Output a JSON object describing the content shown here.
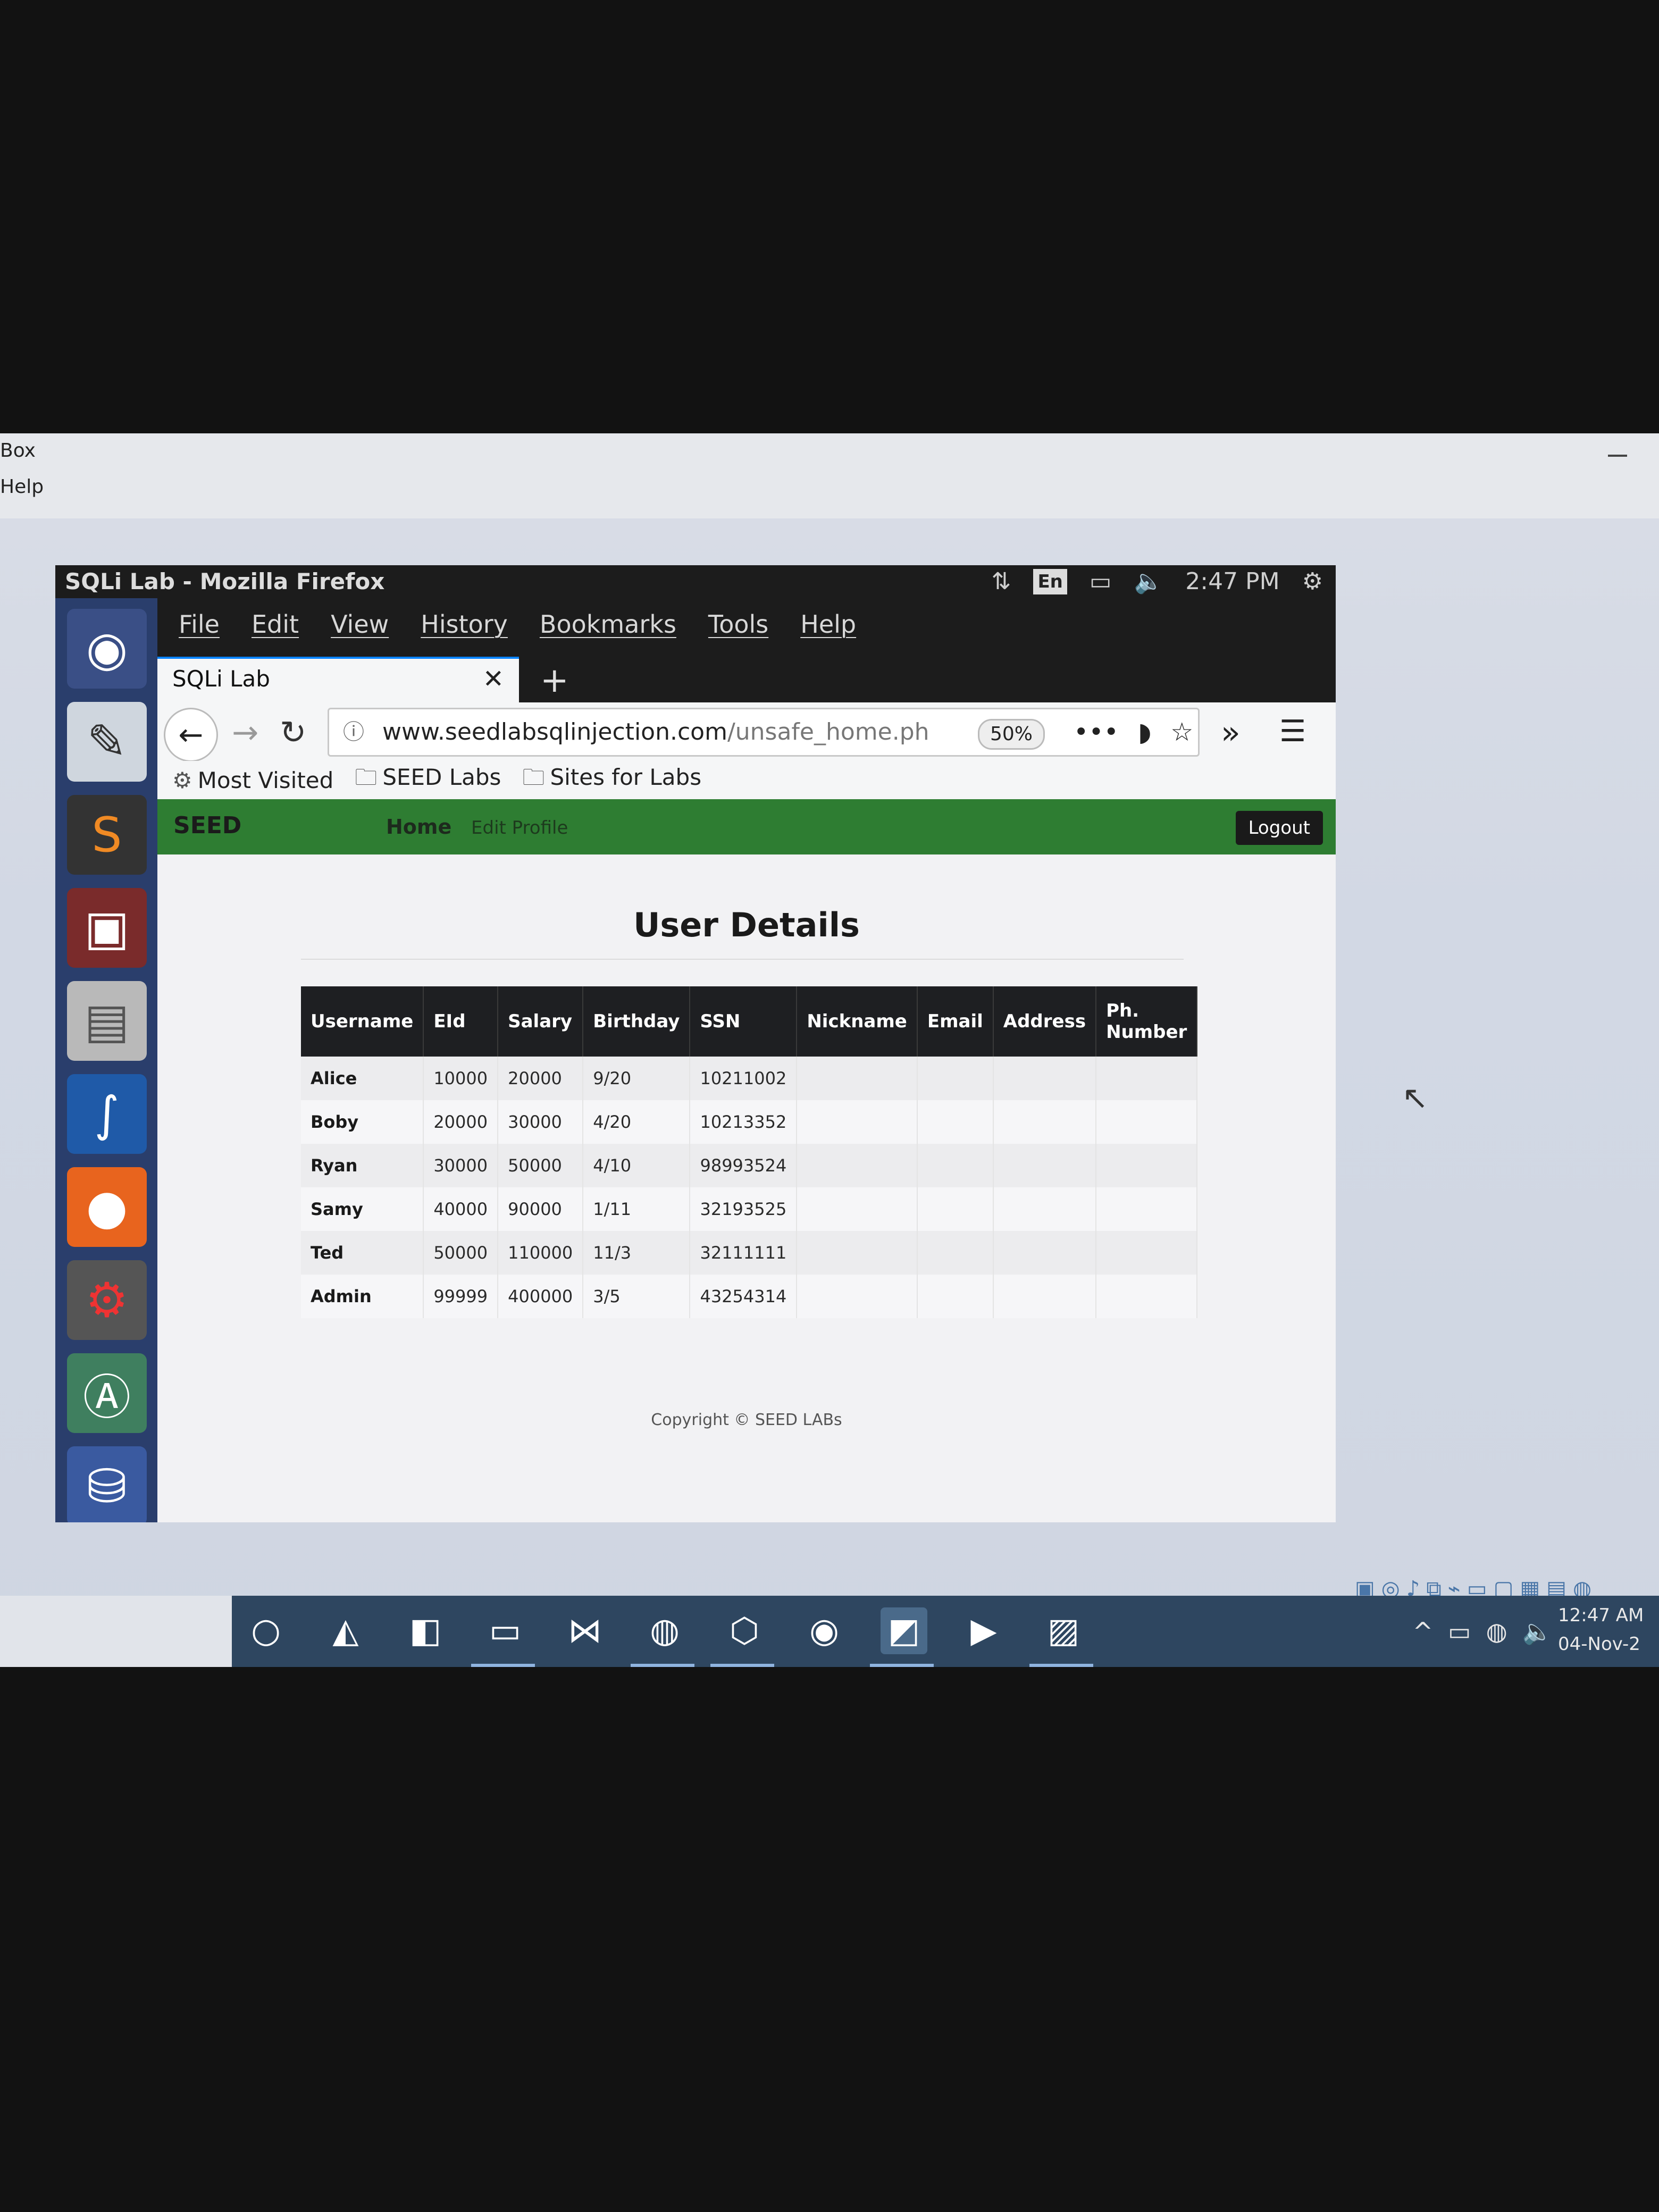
{
  "host": {
    "menu": [
      "Box",
      "Help"
    ]
  },
  "vm": {
    "window_title": "SQLi Lab - Mozilla Firefox",
    "tray": {
      "lang": "En",
      "time": "2:47 PM"
    },
    "launcher": [
      "ubuntu-icon",
      "text-editor-icon",
      "sublime-icon",
      "terminal-icon",
      "files-icon",
      "wireshark-icon",
      "firefox-icon",
      "settings-icon",
      "software-updater-icon",
      "drive-icon"
    ]
  },
  "firefox": {
    "menu": [
      "File",
      "Edit",
      "View",
      "History",
      "Bookmarks",
      "Tools",
      "Help"
    ],
    "tab_title": "SQLi Lab",
    "tab_close": "✕",
    "new_tab": "+",
    "url_host": "www.seedlabsqlinjection.com",
    "url_path": "/unsafe_home.ph",
    "zoom": "50%",
    "bookmarks": [
      "Most Visited",
      "SEED Labs",
      "Sites for Labs"
    ]
  },
  "page": {
    "logo": "SEED",
    "nav": {
      "home": "Home",
      "edit_profile": "Edit Profile"
    },
    "logout": "Logout",
    "title": "User Details",
    "columns": [
      "Username",
      "EId",
      "Salary",
      "Birthday",
      "SSN",
      "Nickname",
      "Email",
      "Address",
      "Ph. Number"
    ],
    "rows": [
      [
        "Alice",
        "10000",
        "20000",
        "9/20",
        "10211002",
        "",
        "",
        "",
        ""
      ],
      [
        "Boby",
        "20000",
        "30000",
        "4/20",
        "10213352",
        "",
        "",
        "",
        ""
      ],
      [
        "Ryan",
        "30000",
        "50000",
        "4/10",
        "98993524",
        "",
        "",
        "",
        ""
      ],
      [
        "Samy",
        "40000",
        "90000",
        "1/11",
        "32193525",
        "",
        "",
        "",
        ""
      ],
      [
        "Ted",
        "50000",
        "110000",
        "11/3",
        "32111111",
        "",
        "",
        "",
        ""
      ],
      [
        "Admin",
        "99999",
        "400000",
        "3/5",
        "43254314",
        "",
        "",
        "",
        ""
      ]
    ],
    "copyright": "Copyright © SEED LABs"
  },
  "taskbar": {
    "clock_time": "12:47 AM",
    "clock_date": "04-Nov-2"
  }
}
